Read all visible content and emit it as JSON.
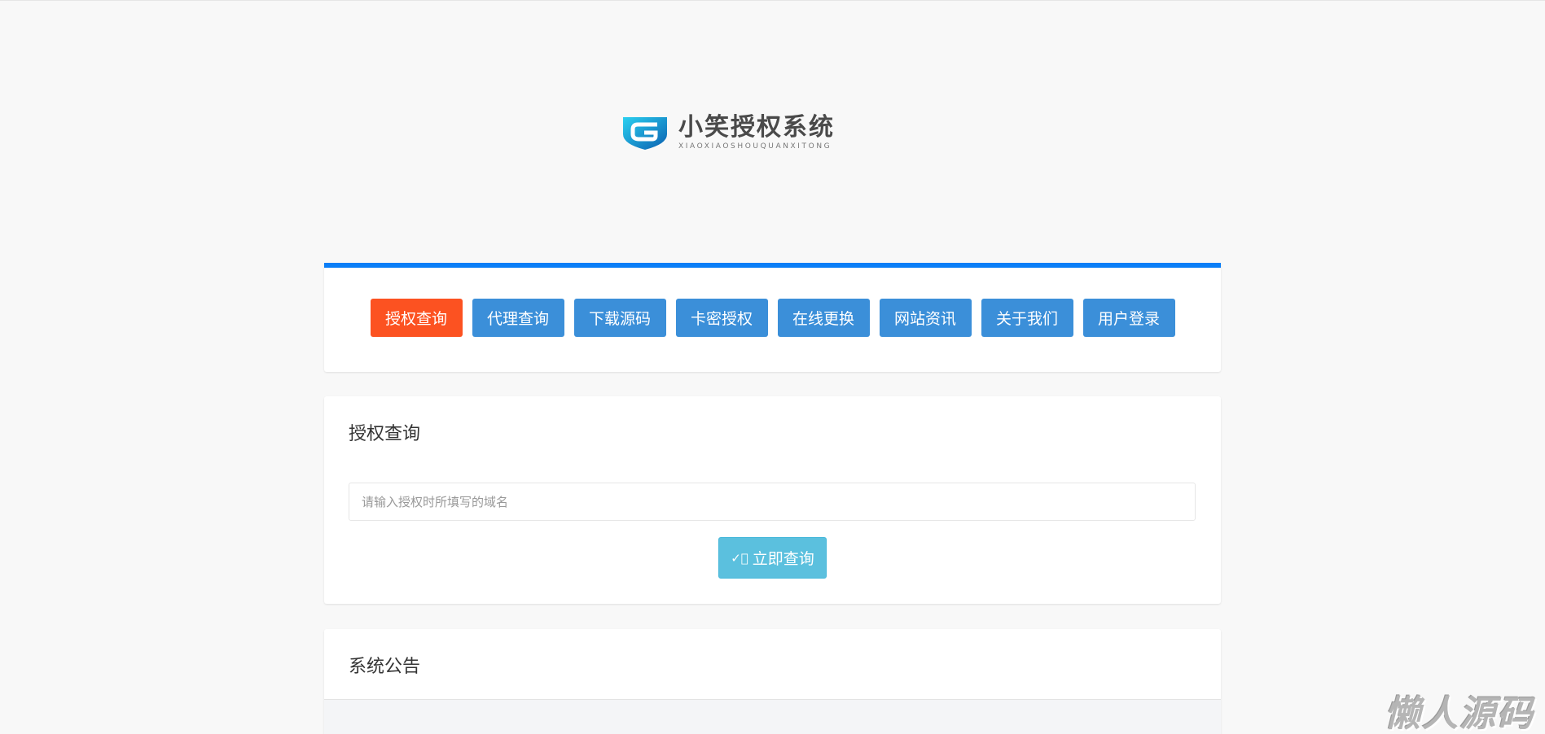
{
  "logo": {
    "title": "小笑授权系统",
    "subtitle": "XIAOXIAOSHOUQUANXITONG"
  },
  "nav": {
    "items": [
      "授权查询",
      "代理查询",
      "下载源码",
      "卡密授权",
      "在线更换",
      "网站资讯",
      "关于我们",
      "用户登录"
    ],
    "active": 0
  },
  "query": {
    "title": "授权查询",
    "placeholder": "请输入授权时所填写的域名",
    "button": "立即查询"
  },
  "notice": {
    "title": "系统公告"
  },
  "watermark": "懒人源码",
  "colors": {
    "accent": "#0a7ef7",
    "active": "#fc5221",
    "nav": "#3b8fd9",
    "query": "#5bc0de"
  }
}
